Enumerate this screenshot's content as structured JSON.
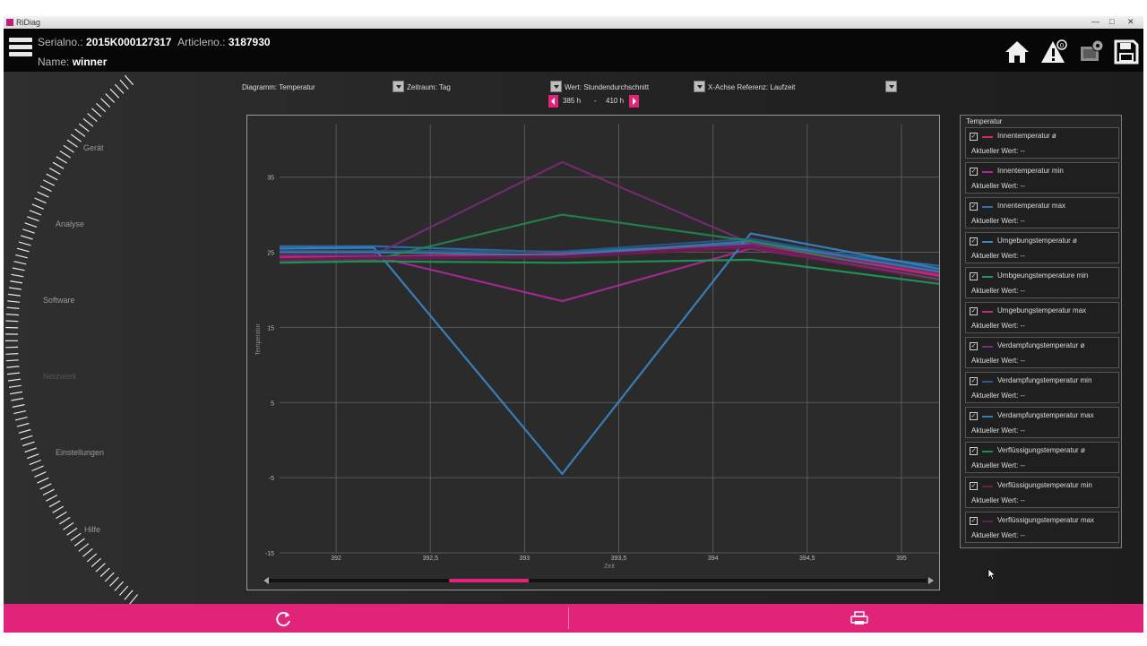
{
  "window": {
    "title": "RiDiag"
  },
  "header": {
    "serial_label": "Serialno.:",
    "serial_value": "2015K000127317",
    "article_label": "Articleno.:",
    "article_value": "3187930",
    "name_label": "Name:",
    "name_value": "winner"
  },
  "nav": {
    "items": [
      {
        "label": "Gerät",
        "active": true
      },
      {
        "label": "Analyse",
        "active": true
      },
      {
        "label": "Software",
        "active": true
      },
      {
        "label": "Netzwerk",
        "active": false
      },
      {
        "label": "Einstellungen",
        "active": true
      },
      {
        "label": "Hilfe",
        "active": true
      }
    ]
  },
  "toolbar": {
    "diagram_label": "Diagramm:",
    "diagram_value": "Temperatur",
    "period_label": "Zeitraum:",
    "period_value": "Tag",
    "value_label": "Wert:",
    "value_value": "Stundendurchschnitt",
    "xaxis_label": "X-Achse Referenz:",
    "xaxis_value": "Laufzeit"
  },
  "range": {
    "from": "385 h",
    "separator": "-",
    "to": "410 h"
  },
  "legend": {
    "title": "Temperatur",
    "current_label": "Aktueller Wert:",
    "current_value": "--",
    "items": [
      {
        "name": "Innentemperatur ø",
        "color": "#d6246e"
      },
      {
        "name": "Innentemperatur min",
        "color": "#b0289a"
      },
      {
        "name": "Innentemperatur max",
        "color": "#2f6fb0"
      },
      {
        "name": "Umgebungstemperatur ø",
        "color": "#3a86c8"
      },
      {
        "name": "Umbgeungstemperature min",
        "color": "#1f9a5a"
      },
      {
        "name": "Umgebungstemperatur max",
        "color": "#c42a7a"
      },
      {
        "name": "Verdampfungstemperatur ø",
        "color": "#7a2a7a"
      },
      {
        "name": "Verdampfungstemperatur min",
        "color": "#2a5a8a"
      },
      {
        "name": "Verdampfungstemperatur max",
        "color": "#3a7ab0"
      },
      {
        "name": "Verflüssigungstemperatur ø",
        "color": "#1f8a4a"
      },
      {
        "name": "Verflüssigungstemperatur min",
        "color": "#6a1f4a"
      },
      {
        "name": "Verflüssigungstemperatur max",
        "color": "#5a1f5a"
      }
    ]
  },
  "chart_data": {
    "type": "line",
    "title": "",
    "xlabel": "Zeit",
    "ylabel": "Temperatur",
    "xlim": [
      391.7,
      395.2
    ],
    "ylim": [
      -15,
      42
    ],
    "x_ticks": [
      392,
      392.5,
      393,
      393.5,
      394,
      394.5,
      395
    ],
    "x_tick_labels": [
      "392",
      "392,5",
      "393",
      "393,5",
      "394",
      "394,5",
      "395"
    ],
    "y_ticks": [
      -15,
      -5,
      5,
      15,
      25,
      35
    ],
    "grid": true,
    "legend_position": "right",
    "series": [
      {
        "name": "Innentemperatur ø",
        "color": "#d6246e",
        "x": [
          391.7,
          392.2,
          393.2,
          394.2,
          395.2
        ],
        "y": [
          24.2,
          24.4,
          24.8,
          25.8,
          21.8
        ]
      },
      {
        "name": "Innentemperatur min",
        "color": "#b0289a",
        "x": [
          391.7,
          392.2,
          393.2,
          394.2,
          395.2
        ],
        "y": [
          24.0,
          24.5,
          18.5,
          25.5,
          21.5
        ]
      },
      {
        "name": "Innentemperatur max",
        "color": "#2f6fb0",
        "x": [
          391.7,
          392.2,
          393.2,
          394.2,
          395.2
        ],
        "y": [
          25.8,
          25.8,
          25.0,
          26.2,
          23.2
        ]
      },
      {
        "name": "Umgebungstemperatur ø",
        "color": "#3a86c8",
        "x": [
          391.7,
          392.2,
          393.2,
          394.2,
          395.2
        ],
        "y": [
          25.5,
          25.6,
          -4.5,
          27.5,
          22.8
        ]
      },
      {
        "name": "Umbgeungstemperature min",
        "color": "#1f9a5a",
        "x": [
          391.7,
          392.2,
          393.2,
          394.2,
          395.2
        ],
        "y": [
          23.6,
          23.8,
          23.6,
          24.0,
          20.8
        ]
      },
      {
        "name": "Umgebungstemperatur max",
        "color": "#c42a7a",
        "x": [
          391.7,
          392.2,
          393.2,
          394.2,
          395.2
        ],
        "y": [
          24.4,
          24.4,
          24.6,
          26.0,
          22.0
        ]
      },
      {
        "name": "Verdampfungstemperatur ø",
        "color": "#7a2a7a",
        "x": [
          391.7,
          392.2,
          393.2,
          394.2,
          395.2
        ],
        "y": [
          24.6,
          24.6,
          37.0,
          26.2,
          22.3
        ]
      },
      {
        "name": "Verdampfungstemperatur min",
        "color": "#2a5a8a",
        "x": [
          391.7,
          392.2,
          393.2,
          394.2,
          395.2
        ],
        "y": [
          25.2,
          25.2,
          25.1,
          26.8,
          22.6
        ]
      },
      {
        "name": "Verdampfungstemperatur max",
        "color": "#3a7ab0",
        "x": [
          391.7,
          392.2,
          393.2,
          394.2,
          395.2
        ],
        "y": [
          25.0,
          25.0,
          24.6,
          26.5,
          22.4
        ]
      },
      {
        "name": "Verflüssigungstemperatur ø",
        "color": "#1f8a4a",
        "x": [
          391.7,
          392.2,
          393.2,
          394.2,
          395.2
        ],
        "y": [
          23.8,
          24.0,
          30.0,
          26.5,
          21.4
        ]
      },
      {
        "name": "Verflüssigungstemperatur min",
        "color": "#6a1f4a",
        "x": [
          391.7,
          392.2,
          393.2,
          394.2,
          395.2
        ],
        "y": [
          23.9,
          24.1,
          24.3,
          25.6,
          21.2
        ]
      },
      {
        "name": "Verflüssigungstemperatur max",
        "color": "#5a1f5a",
        "x": [
          391.7,
          392.2,
          393.2,
          394.2,
          395.2
        ],
        "y": [
          24.1,
          24.3,
          24.5,
          25.9,
          21.6
        ]
      }
    ]
  },
  "scrollbar": {
    "thumb_start": 0.28,
    "thumb_end": 0.4
  },
  "footer": {
    "left_icon": "refresh-icon",
    "right_icon": "printer-icon"
  },
  "icons": {
    "menu": "menu-icon",
    "home": "home-icon",
    "warning": "warning-icon",
    "device": "device-settings-icon",
    "save": "save-icon"
  },
  "colors": {
    "accent": "#e2237a",
    "background": "#262626"
  }
}
